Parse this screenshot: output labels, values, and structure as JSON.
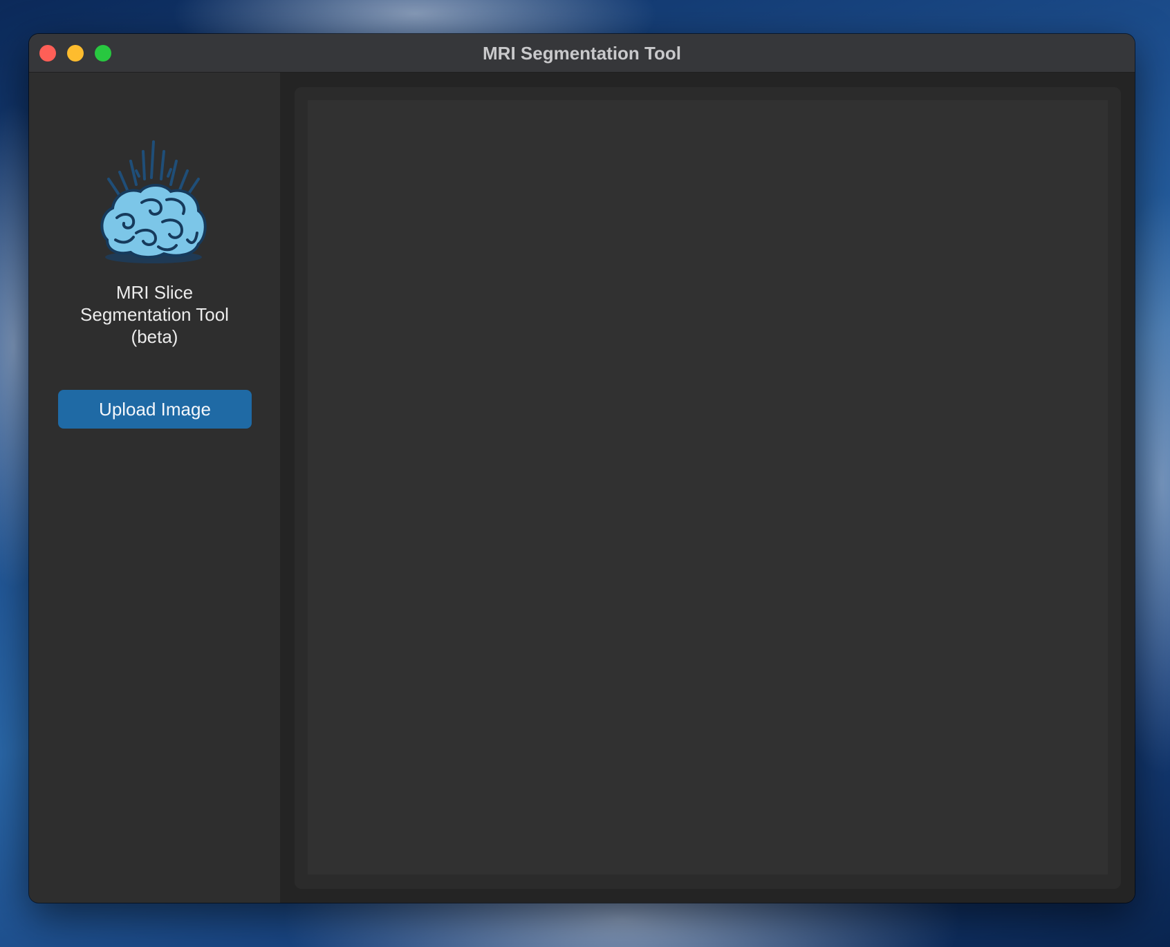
{
  "window": {
    "title": "MRI Segmentation Tool"
  },
  "sidebar": {
    "logo_icon": "brain-icon",
    "app_name_lines": [
      "MRI Slice",
      "Segmentation Tool",
      "(beta)"
    ],
    "upload_button_label": "Upload Image"
  },
  "colors": {
    "accent": "#1f6aa5",
    "logo_brain": "#7cc6e8",
    "sidebar_bg": "#2e2e2e",
    "main_bg": "#242424"
  }
}
